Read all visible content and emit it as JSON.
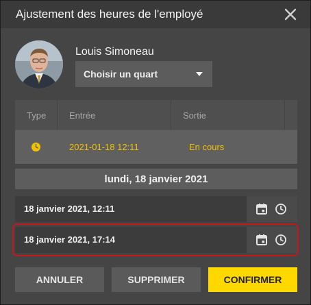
{
  "dialog": {
    "title": "Ajustement des heures de l'employé",
    "close_icon": "close-icon"
  },
  "employee": {
    "name": "Louis Simoneau",
    "avatar": "employee-photo"
  },
  "shift_select": {
    "value": "Choisir un quart",
    "icon": "dropdown-caret-icon"
  },
  "shifts_table": {
    "headers": {
      "type": "Type",
      "entry": "Entrée",
      "exit": "Sortie"
    },
    "rows": [
      {
        "type_icon": "clock-icon",
        "entry": "2021-01-18 12:11",
        "exit": "En cours"
      }
    ]
  },
  "date_header": "lundi, 18 janvier 2021",
  "start_datetime": {
    "value": "18 janvier 2021, 12:11",
    "icons": [
      "calendar-icon",
      "clock-icon"
    ]
  },
  "end_datetime": {
    "value": "18 janvier 2021, 17:14",
    "icons": [
      "calendar-icon",
      "clock-icon"
    ]
  },
  "buttons": {
    "cancel": "ANNULER",
    "delete": "SUPPRIMER",
    "confirm": "CONFIRMER"
  },
  "colors": {
    "accent": "#ffd800",
    "in_progress_text": "#f2c200",
    "highlight_border": "#c0181d",
    "dialog_bg": "#454545"
  }
}
